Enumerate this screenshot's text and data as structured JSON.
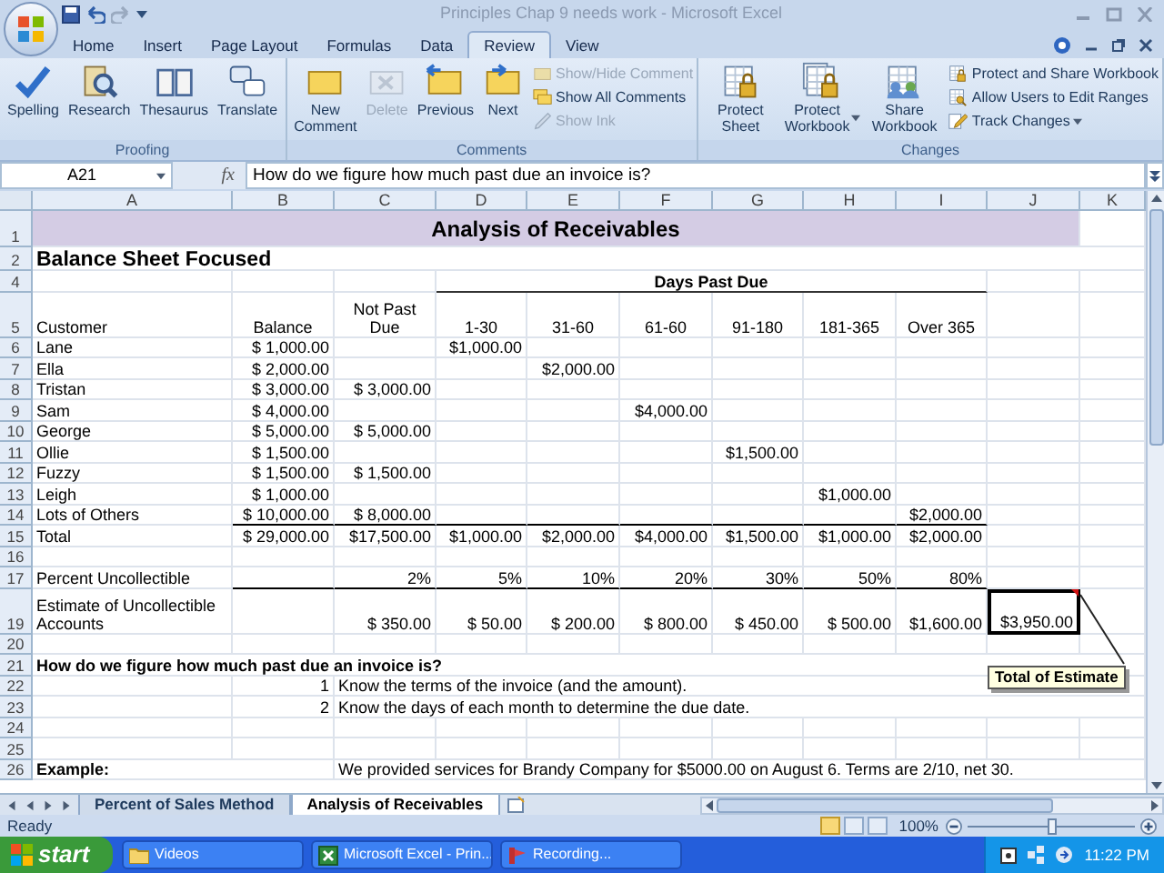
{
  "window": {
    "title": "Principles Chap 9 needs work - Microsoft Excel"
  },
  "ribbon_tabs": [
    {
      "label": "Home",
      "selected": false
    },
    {
      "label": "Insert",
      "selected": false
    },
    {
      "label": "Page Layout",
      "selected": false
    },
    {
      "label": "Formulas",
      "selected": false
    },
    {
      "label": "Data",
      "selected": false
    },
    {
      "label": "Review",
      "selected": true
    },
    {
      "label": "View",
      "selected": false
    }
  ],
  "ribbon_groups": [
    {
      "label": "Proofing",
      "buttons": [
        {
          "label": "Spelling",
          "kind": "large",
          "disabled": false
        },
        {
          "label": "Research",
          "kind": "large",
          "disabled": false
        },
        {
          "label": "Thesaurus",
          "kind": "large",
          "disabled": false
        },
        {
          "label": "Translate",
          "kind": "large",
          "disabled": false
        }
      ]
    },
    {
      "label": "Comments",
      "buttons": [
        {
          "label": "New Comment",
          "kind": "large",
          "disabled": false
        },
        {
          "label": "Delete",
          "kind": "large",
          "disabled": true
        },
        {
          "label": "Previous",
          "kind": "large",
          "disabled": false
        },
        {
          "label": "Next",
          "kind": "large",
          "disabled": false
        },
        {
          "label": "Show/Hide Comment",
          "kind": "small",
          "disabled": true
        },
        {
          "label": "Show All Comments",
          "kind": "small",
          "disabled": false
        },
        {
          "label": "Show Ink",
          "kind": "small",
          "disabled": true
        }
      ]
    },
    {
      "label": "Changes",
      "buttons": [
        {
          "label": "Protect Sheet",
          "kind": "large",
          "disabled": false
        },
        {
          "label": "Protect Workbook",
          "kind": "large",
          "disabled": false,
          "dropdown": true
        },
        {
          "label": "Share Workbook",
          "kind": "large",
          "disabled": false
        },
        {
          "label": "Protect and Share Workbook",
          "kind": "small",
          "disabled": false
        },
        {
          "label": "Allow Users to Edit Ranges",
          "kind": "small",
          "disabled": false
        },
        {
          "label": "Track Changes",
          "kind": "small",
          "disabled": false,
          "dropdown": true
        }
      ]
    }
  ],
  "formula_bar": {
    "name_box": "A21",
    "function_label": "fx",
    "formula": "How do we figure how much past due an invoice is?"
  },
  "sheet": {
    "columns": [
      "A",
      "B",
      "C",
      "D",
      "E",
      "F",
      "G",
      "H",
      "I",
      "J",
      "K"
    ],
    "rows": [
      {
        "number": "1",
        "title": "Analysis of Receivables",
        "cells": [
          null,
          null,
          null,
          null,
          null,
          null,
          null,
          null,
          null,
          null,
          null
        ]
      },
      {
        "number": "2",
        "cells": [
          {
            "text": "Balance Sheet Focused",
            "kind": "heading"
          },
          null,
          null,
          null,
          null,
          null,
          null,
          null,
          null,
          null,
          null
        ]
      },
      {
        "number": "4",
        "group_header": "Days Past Due",
        "cells": [
          null,
          null,
          null,
          null,
          null,
          null,
          null,
          null,
          null,
          null,
          null
        ]
      },
      {
        "number": "5",
        "cells": [
          {
            "text": "Customer",
            "kind": "text"
          },
          {
            "text": "Balance",
            "kind": "center"
          },
          {
            "text": "Not Past Due",
            "kind": "stack"
          },
          {
            "text": "1-30",
            "kind": "center"
          },
          {
            "text": "31-60",
            "kind": "center"
          },
          {
            "text": "61-60",
            "kind": "center"
          },
          {
            "text": "91-180",
            "kind": "center"
          },
          {
            "text": "181-365",
            "kind": "center"
          },
          {
            "text": "Over 365",
            "kind": "stack"
          },
          null,
          null
        ]
      },
      {
        "number": "6",
        "cells": [
          {
            "text": "Lane",
            "kind": "text"
          },
          {
            "text": "$ 1,000.00",
            "kind": "num"
          },
          null,
          {
            "text": "$1,000.00",
            "kind": "num"
          },
          null,
          null,
          null,
          null,
          null,
          null,
          null
        ]
      },
      {
        "number": "7",
        "cells": [
          {
            "text": "Ella",
            "kind": "text"
          },
          {
            "text": "$ 2,000.00",
            "kind": "num"
          },
          null,
          null,
          {
            "text": "$2,000.00",
            "kind": "num"
          },
          null,
          null,
          null,
          null,
          null,
          null
        ]
      },
      {
        "number": "8",
        "cells": [
          {
            "text": "Tristan",
            "kind": "text"
          },
          {
            "text": "$ 3,000.00",
            "kind": "num"
          },
          {
            "text": "$ 3,000.00",
            "kind": "num"
          },
          null,
          null,
          null,
          null,
          null,
          null,
          null,
          null
        ]
      },
      {
        "number": "9",
        "cells": [
          {
            "text": "Sam",
            "kind": "text"
          },
          {
            "text": "$ 4,000.00",
            "kind": "num"
          },
          null,
          null,
          null,
          {
            "text": "$4,000.00",
            "kind": "num"
          },
          null,
          null,
          null,
          null,
          null
        ]
      },
      {
        "number": "10",
        "cells": [
          {
            "text": "George",
            "kind": "text"
          },
          {
            "text": "$ 5,000.00",
            "kind": "num"
          },
          {
            "text": "$ 5,000.00",
            "kind": "num"
          },
          null,
          null,
          null,
          null,
          null,
          null,
          null,
          null
        ]
      },
      {
        "number": "11",
        "cells": [
          {
            "text": "Ollie",
            "kind": "text"
          },
          {
            "text": "$ 1,500.00",
            "kind": "num"
          },
          null,
          null,
          null,
          null,
          {
            "text": "$1,500.00",
            "kind": "num"
          },
          null,
          null,
          null,
          null
        ]
      },
      {
        "number": "12",
        "cells": [
          {
            "text": "Fuzzy",
            "kind": "text"
          },
          {
            "text": "$ 1,500.00",
            "kind": "num"
          },
          {
            "text": "$ 1,500.00",
            "kind": "num"
          },
          null,
          null,
          null,
          null,
          null,
          null,
          null,
          null
        ]
      },
      {
        "number": "13",
        "cells": [
          {
            "text": "Leigh",
            "kind": "text"
          },
          {
            "text": "$ 1,000.00",
            "kind": "num"
          },
          null,
          null,
          null,
          null,
          null,
          {
            "text": "$1,000.00",
            "kind": "num"
          },
          null,
          null,
          null
        ]
      },
      {
        "number": "14",
        "rule_below": true,
        "cells": [
          {
            "text": "Lots of Others",
            "kind": "text"
          },
          {
            "text": "$ 10,000.00",
            "kind": "num"
          },
          {
            "text": "$ 8,000.00",
            "kind": "num"
          },
          null,
          null,
          null,
          null,
          null,
          {
            "text": "$2,000.00",
            "kind": "num"
          },
          null,
          null
        ]
      },
      {
        "number": "15",
        "cells": [
          {
            "text": "Total",
            "kind": "text"
          },
          {
            "text": "$ 29,000.00",
            "kind": "num"
          },
          {
            "text": "$17,500.00",
            "kind": "num"
          },
          {
            "text": "$1,000.00",
            "kind": "num"
          },
          {
            "text": "$2,000.00",
            "kind": "num"
          },
          {
            "text": "$4,000.00",
            "kind": "num"
          },
          {
            "text": "$1,500.00",
            "kind": "num"
          },
          {
            "text": "$1,000.00",
            "kind": "num"
          },
          {
            "text": "$2,000.00",
            "kind": "num"
          },
          null,
          null
        ]
      },
      {
        "number": "16",
        "cells": [
          null,
          null,
          null,
          null,
          null,
          null,
          null,
          null,
          null,
          null,
          null
        ]
      },
      {
        "number": "17",
        "rule_below": true,
        "cells": [
          {
            "text": "Percent Uncollectible",
            "kind": "text"
          },
          null,
          {
            "text": "2%",
            "kind": "num"
          },
          {
            "text": "5%",
            "kind": "num"
          },
          {
            "text": "10%",
            "kind": "num"
          },
          {
            "text": "20%",
            "kind": "num"
          },
          {
            "text": "30%",
            "kind": "num"
          },
          {
            "text": "50%",
            "kind": "num"
          },
          {
            "text": "80%",
            "kind": "num"
          },
          null,
          null
        ]
      },
      {
        "number": "19",
        "cells": [
          {
            "text": "Estimate of Uncollectible Accounts",
            "kind": "wrap"
          },
          null,
          {
            "text": "$ 350.00",
            "kind": "num"
          },
          {
            "text": "$ 50.00",
            "kind": "num"
          },
          {
            "text": "$ 200.00",
            "kind": "num"
          },
          {
            "text": "$ 800.00",
            "kind": "num"
          },
          {
            "text": "$ 450.00",
            "kind": "num"
          },
          {
            "text": "$ 500.00",
            "kind": "num"
          },
          {
            "text": "$1,600.00",
            "kind": "num"
          },
          {
            "text": "$3,950.00",
            "kind": "boxed"
          },
          null
        ]
      },
      {
        "number": "20",
        "cells": [
          null,
          null,
          null,
          null,
          null,
          null,
          null,
          null,
          null,
          null,
          null
        ]
      },
      {
        "number": "21",
        "cells": [
          {
            "text": "How do we figure how much past due an invoice is?",
            "kind": "bold"
          },
          null,
          null,
          null,
          null,
          null,
          null,
          null,
          null,
          null,
          null
        ]
      },
      {
        "number": "22",
        "cells": [
          null,
          {
            "text": "1",
            "kind": "num"
          },
          {
            "text": "Know the terms of the invoice (and the amount).",
            "kind": "over"
          },
          null,
          null,
          null,
          null,
          null,
          null,
          null,
          null
        ]
      },
      {
        "number": "23",
        "cells": [
          null,
          {
            "text": "2",
            "kind": "num"
          },
          {
            "text": "Know the days of each month to determine the due date.",
            "kind": "over"
          },
          null,
          null,
          null,
          null,
          null,
          null,
          null,
          null
        ]
      },
      {
        "number": "24",
        "cells": [
          null,
          null,
          null,
          null,
          null,
          null,
          null,
          null,
          null,
          null,
          null
        ]
      },
      {
        "number": "25",
        "cells": [
          null,
          null,
          null,
          null,
          null,
          null,
          null,
          null,
          null,
          null,
          null
        ]
      },
      {
        "number": "26",
        "cells": [
          {
            "text": "Example:",
            "kind": "bold"
          },
          null,
          {
            "text": "We provided services for Brandy Company for $5000.00 on August 6.  Terms are 2/10, net 30.",
            "kind": "over"
          },
          null,
          null,
          null,
          null,
          null,
          null,
          null,
          null
        ]
      }
    ],
    "comment": {
      "text": "Total of Estimate"
    }
  },
  "sheet_tabs": [
    {
      "label": "Percent of Sales Method",
      "selected": false
    },
    {
      "label": "Analysis of Receivables",
      "selected": true
    }
  ],
  "status_bar": {
    "text": "Ready",
    "zoom": "100%",
    "zoom_slider": {
      "level": 0.5
    }
  },
  "taskbar": {
    "start": "start",
    "items": [
      {
        "label": "Videos",
        "kind": "folder"
      },
      {
        "label": "Microsoft Excel - Prin...",
        "kind": "excel"
      },
      {
        "label": "Recording...",
        "kind": "recording"
      }
    ],
    "clock": "11:22 PM"
  }
}
